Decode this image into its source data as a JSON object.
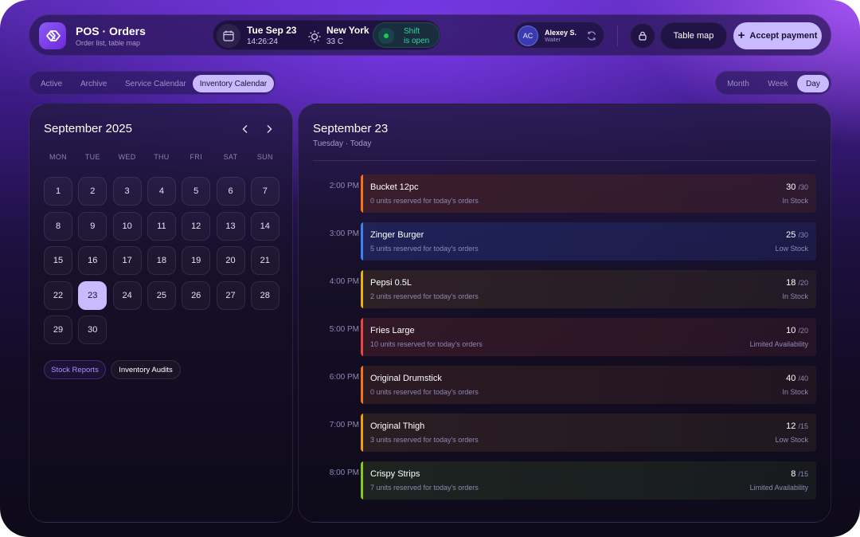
{
  "app": {
    "title": "POS · Orders",
    "subtitle": "Order list, table map"
  },
  "datetime": {
    "date": "Tue Sep 23",
    "time": "14:26:24"
  },
  "weather": {
    "city": "New York",
    "temp": "33 C"
  },
  "shift": {
    "line1": "Shift",
    "line2": "is open",
    "color": "#22c55e"
  },
  "user": {
    "initials": "AC",
    "name": "Alexey S.",
    "role": "Waiter"
  },
  "buttons": {
    "table_map": "Table map",
    "accept_payment": "Accept payment"
  },
  "tabs": [
    {
      "label": "Active",
      "active": false
    },
    {
      "label": "Archive",
      "active": false
    },
    {
      "label": "Service Calendar",
      "active": false
    },
    {
      "label": "Inventory Calendar",
      "active": true
    }
  ],
  "views": [
    {
      "label": "Month",
      "active": false
    },
    {
      "label": "Week",
      "active": false
    },
    {
      "label": "Day",
      "active": true
    }
  ],
  "calendar": {
    "title": "September 2025",
    "weekdays": [
      "MON",
      "TUE",
      "WED",
      "THU",
      "FRI",
      "SAT",
      "SUN"
    ],
    "days": [
      "1",
      "2",
      "3",
      "4",
      "5",
      "6",
      "7",
      "8",
      "9",
      "10",
      "11",
      "12",
      "13",
      "14",
      "15",
      "16",
      "17",
      "18",
      "19",
      "20",
      "21",
      "22",
      "23",
      "24",
      "25",
      "26",
      "27",
      "28",
      "29",
      "30"
    ],
    "selected_day": "23",
    "chips": [
      "Stock Reports",
      "Inventory Audits"
    ]
  },
  "day_view": {
    "title": "September 23",
    "subtitle": "Tuesday · Today",
    "events": [
      {
        "time": "2:00 PM",
        "name": "Bucket 12pc",
        "desc": "0 units reserved for today's orders",
        "qty": "30",
        "total": "/30",
        "status": "In Stock",
        "accent": "#f97316",
        "bg": "#3a1d2a"
      },
      {
        "time": "3:00 PM",
        "name": "Zinger Burger",
        "desc": "5 units reserved for today's orders",
        "qty": "25",
        "total": "/30",
        "status": "Low Stock",
        "accent": "#3b82f6",
        "bg": "#1f2157"
      },
      {
        "time": "4:00 PM",
        "name": "Pepsi 0.5L",
        "desc": "2 units reserved for today's orders",
        "qty": "18",
        "total": "/20",
        "status": "In Stock",
        "accent": "#eab308",
        "bg": "#2d2126"
      },
      {
        "time": "5:00 PM",
        "name": "Fries Large",
        "desc": "10 units reserved for today's orders",
        "qty": "10",
        "total": "/20",
        "status": "Limited Availability",
        "accent": "#ef4444",
        "bg": "#321827"
      },
      {
        "time": "6:00 PM",
        "name": "Original Drumstick",
        "desc": "0 units reserved for today's orders",
        "qty": "40",
        "total": "/40",
        "status": "In Stock",
        "accent": "#f97316",
        "bg": "#2b1a22"
      },
      {
        "time": "7:00 PM",
        "name": "Original Thigh",
        "desc": "3 units reserved for today's orders",
        "qty": "12",
        "total": "/15",
        "status": "Low Stock",
        "accent": "#f59e0b",
        "bg": "#2a1e22"
      },
      {
        "time": "8:00 PM",
        "name": "Crispy Strips",
        "desc": "7 units reserved for today's orders",
        "qty": "8",
        "total": "/15",
        "status": "Limited Availability",
        "accent": "#84cc16",
        "bg": "#1d2420"
      }
    ]
  }
}
